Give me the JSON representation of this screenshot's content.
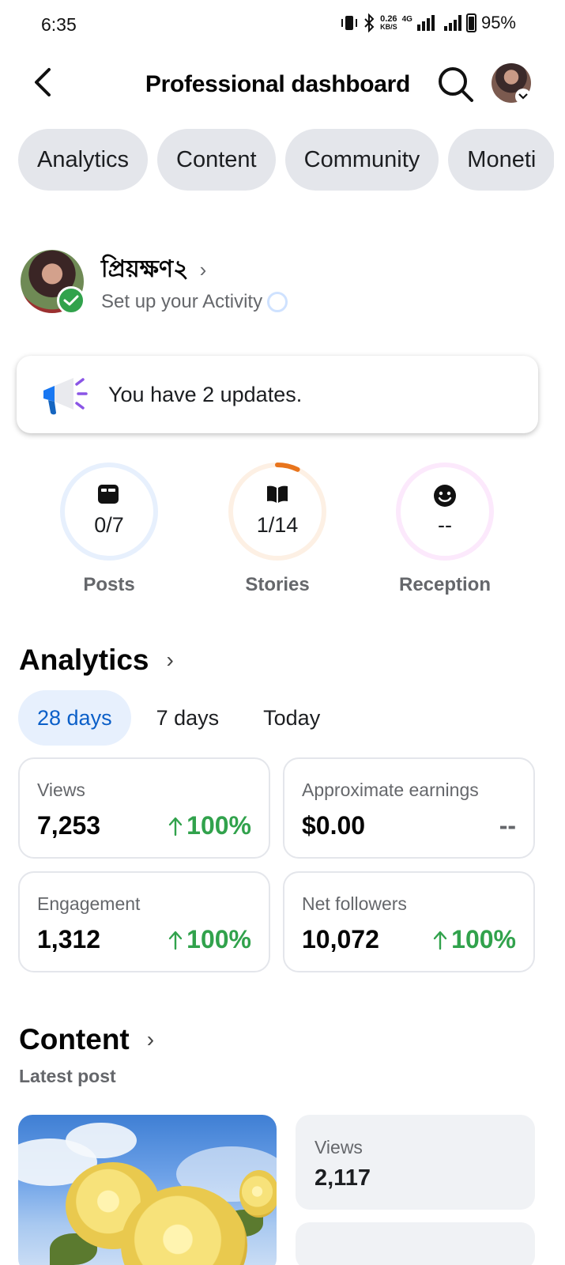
{
  "status_bar": {
    "time": "6:35",
    "net_speed_value": "0.26",
    "net_speed_unit": "KB/S",
    "network": "4G",
    "battery": "95%"
  },
  "header": {
    "title": "Professional dashboard"
  },
  "tabs": [
    {
      "label": "Analytics"
    },
    {
      "label": "Content"
    },
    {
      "label": "Community"
    },
    {
      "label": "Moneti"
    }
  ],
  "profile": {
    "name": "প্রিয়ক্ষণ২",
    "subtitle": "Set up your Activity"
  },
  "updates": {
    "text": "You have 2 updates."
  },
  "rings": [
    {
      "label": "Posts",
      "value": "0/7",
      "progress": 0,
      "color": "#1877f2",
      "track": "#e7f0fd"
    },
    {
      "label": "Stories",
      "value": "1/14",
      "progress": 0.0714,
      "color": "#e8741c",
      "track": "#fdf0e4"
    },
    {
      "label": "Reception",
      "value": "--",
      "progress": 0,
      "color": "#d63ad6",
      "track": "#fce9fc"
    }
  ],
  "analytics": {
    "title": "Analytics",
    "periods": [
      "28 days",
      "7 days",
      "Today"
    ],
    "active_period": "28 days",
    "stats": [
      {
        "label": "Views",
        "value": "7,253",
        "change": "100%"
      },
      {
        "label": "Approximate earnings",
        "value": "$0.00",
        "change": "--"
      },
      {
        "label": "Engagement",
        "value": "1,312",
        "change": "100%"
      },
      {
        "label": "Net followers",
        "value": "10,072",
        "change": "100%"
      }
    ]
  },
  "content": {
    "title": "Content",
    "subtitle": "Latest post",
    "latest_views_label": "Views",
    "latest_views_value": "2,117"
  },
  "colors": {
    "accent": "#1877f2",
    "positive": "#31a24c",
    "chip_bg": "#e4e6eb"
  }
}
